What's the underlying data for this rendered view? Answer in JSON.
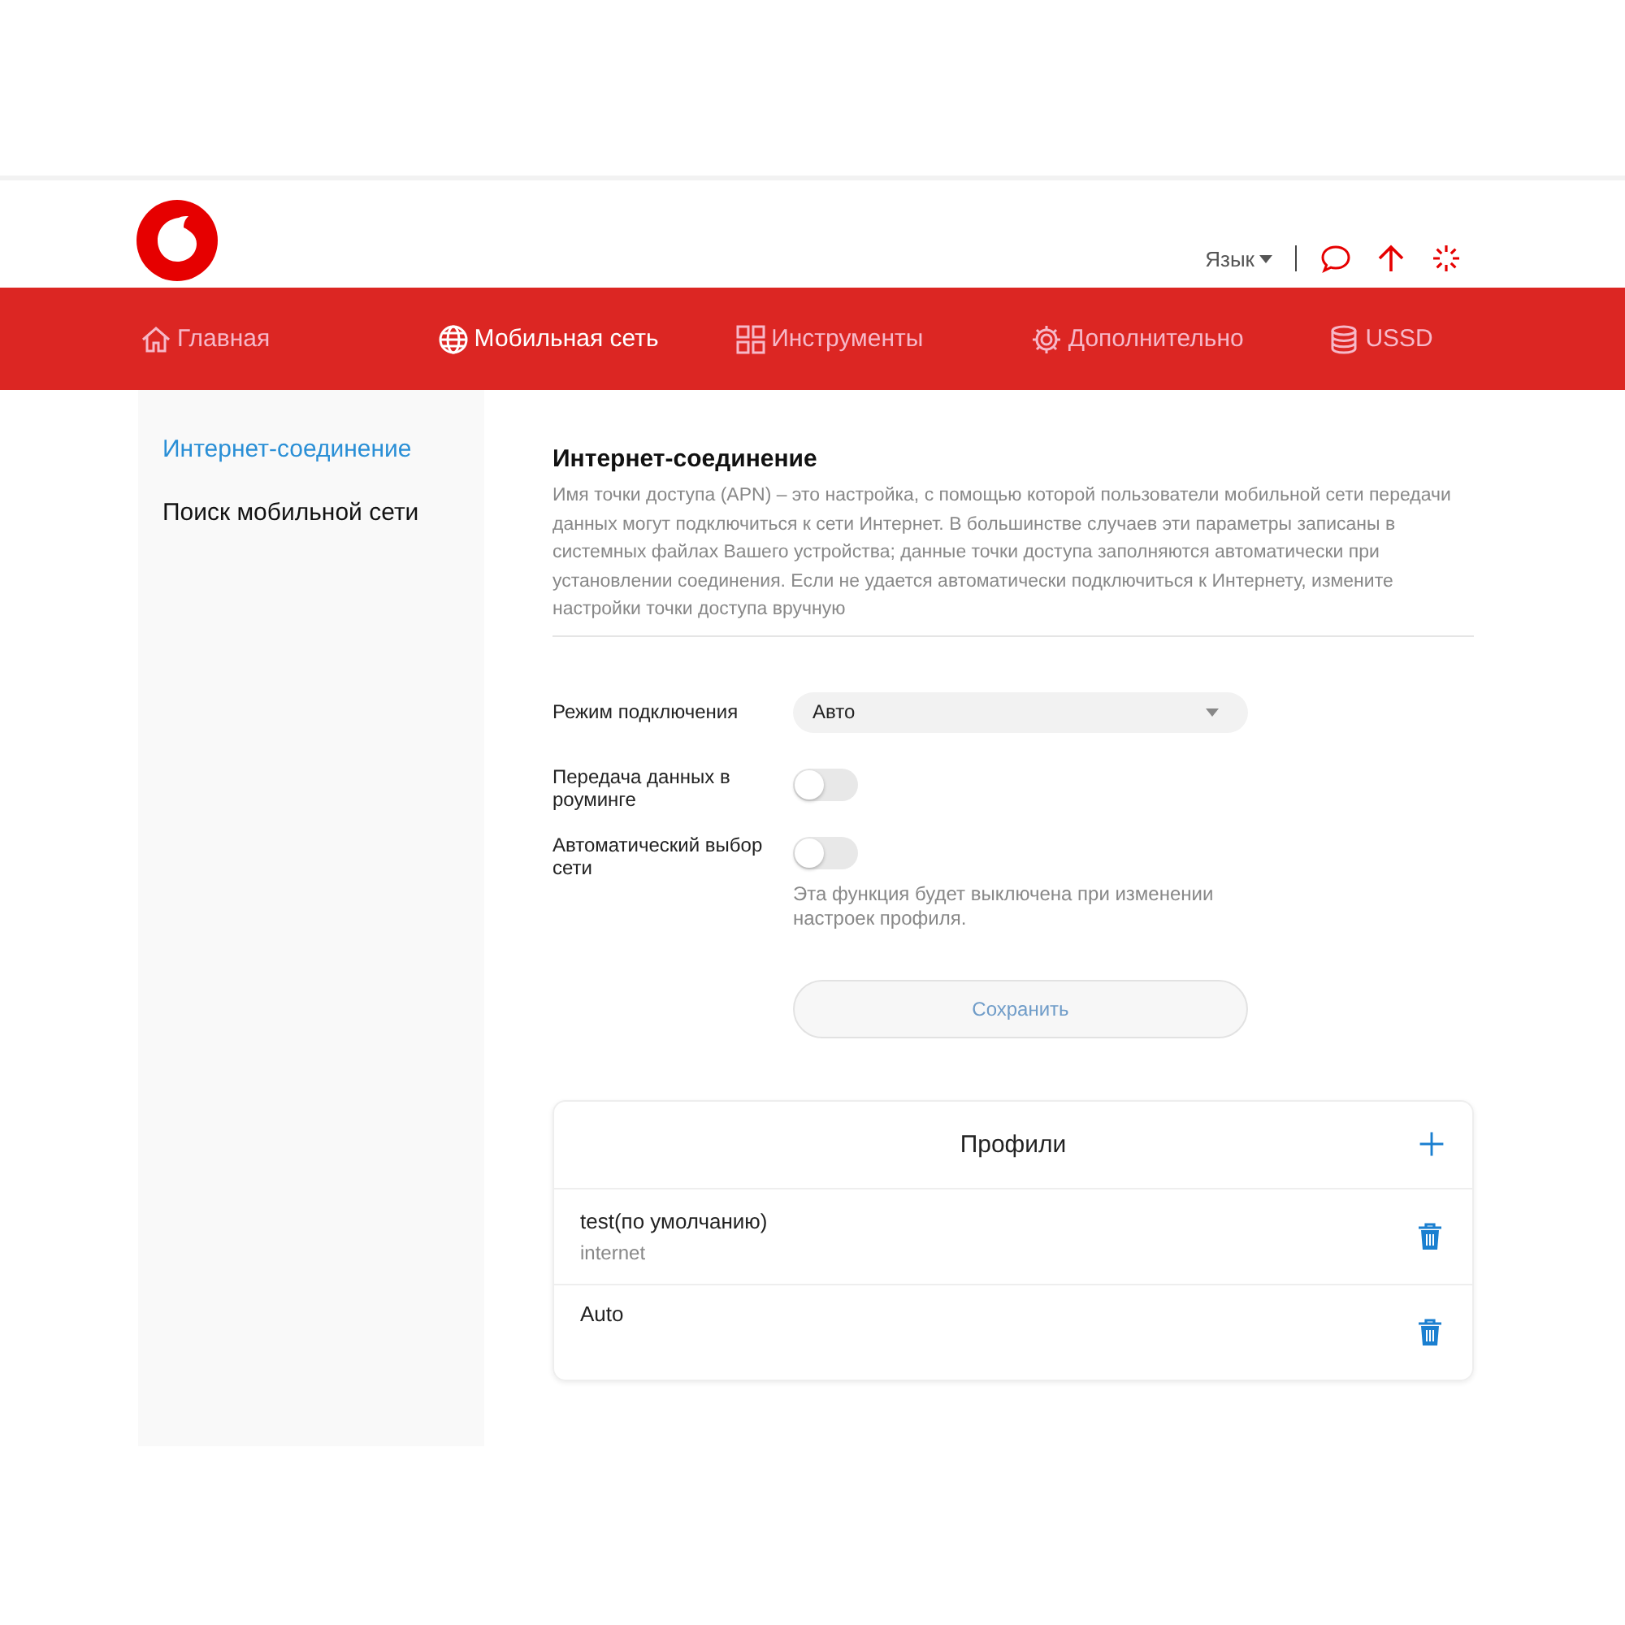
{
  "header": {
    "language": "Язык"
  },
  "nav": [
    {
      "label": "Главная",
      "kind": "home",
      "selected": false
    },
    {
      "label": "Мобильная сеть",
      "kind": "network",
      "selected": true
    },
    {
      "label": "Инструменты",
      "kind": "tools",
      "selected": false
    },
    {
      "label": "Дополнительно",
      "kind": "advanced",
      "selected": false
    },
    {
      "label": "USSD",
      "kind": "ussd",
      "selected": false
    }
  ],
  "sidebar": {
    "items": [
      {
        "label": "Интернет-соединение",
        "selected": true
      },
      {
        "label": "Поиск мобильной сети",
        "selected": false
      }
    ]
  },
  "section": {
    "title": "Интернет-соединение",
    "description": "Имя точки доступа (APN) – это настройка, с помощью которой пользователи мобильной сети передачи данных могут подключиться к сети Интернет. В большинстве случаев эти параметры записаны в системных файлах Вашего устройства; данные точки доступа заполняются автоматически при установлении соединения. Если не удается автоматически подключиться к Интернету, измените настройки точки доступа вручную"
  },
  "form": {
    "mode": {
      "label": "Режим подключения",
      "value": "Авто"
    },
    "toggles": [
      {
        "label": "Передача данных в роуминге",
        "on": false
      },
      {
        "label": "Автоматический выбор сети",
        "on": false,
        "hint": "Эта функция будет выключена при изменении настроек профиля."
      }
    ],
    "save": {
      "label": "Сохранить",
      "disabled": true
    }
  },
  "profiles": {
    "title": "Профили",
    "items": [
      {
        "name": "test(по умолчанию)",
        "apn": "internet"
      },
      {
        "name": "Auto"
      }
    ]
  }
}
